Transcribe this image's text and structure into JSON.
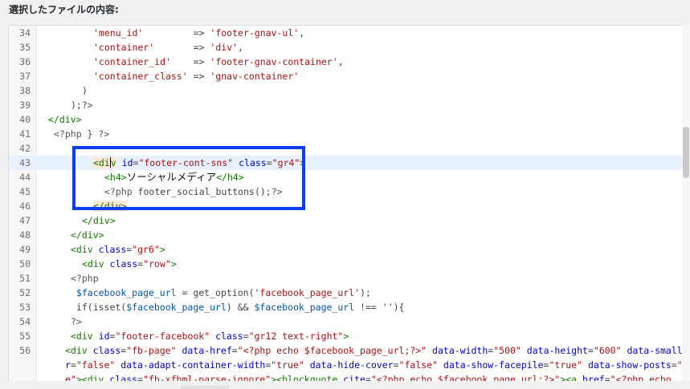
{
  "header": {
    "label": "選択したファイルの内容:"
  },
  "lines": [
    {
      "n": "34",
      "indent": 10,
      "parts": [
        [
          "str",
          "'menu_id'"
        ],
        [
          "op",
          "         => "
        ],
        [
          "str",
          "'footer-gnav-ul'"
        ],
        [
          "op",
          ","
        ]
      ]
    },
    {
      "n": "35",
      "indent": 10,
      "parts": [
        [
          "str",
          "'container'"
        ],
        [
          "op",
          "       => "
        ],
        [
          "str",
          "'div'"
        ],
        [
          "op",
          ","
        ]
      ]
    },
    {
      "n": "36",
      "indent": 10,
      "parts": [
        [
          "str",
          "'container_id'"
        ],
        [
          "op",
          "    => "
        ],
        [
          "str",
          "'footer-gnav-container'"
        ],
        [
          "op",
          ","
        ]
      ]
    },
    {
      "n": "37",
      "indent": 10,
      "parts": [
        [
          "str",
          "'container_class'"
        ],
        [
          "op",
          " => "
        ],
        [
          "str",
          "'gnav-container'"
        ]
      ]
    },
    {
      "n": "38",
      "indent": 8,
      "parts": [
        [
          "op",
          ")"
        ]
      ]
    },
    {
      "n": "39",
      "indent": 6,
      "parts": [
        [
          "op",
          ");"
        ],
        [
          "php",
          "?>"
        ]
      ]
    },
    {
      "n": "40",
      "indent": 2,
      "parts": [
        [
          "tag",
          "</div>"
        ]
      ]
    },
    {
      "n": "41",
      "indent": 3,
      "parts": [
        [
          "php",
          "<?php"
        ],
        [
          "op",
          " } "
        ],
        [
          "php",
          "?>"
        ]
      ]
    },
    {
      "n": "42",
      "indent": 0,
      "parts": []
    },
    {
      "n": "43",
      "indent": 10,
      "active": true,
      "parts": [
        [
          "tag-hl",
          "<div"
        ],
        [
          "op",
          " "
        ],
        [
          "attr",
          "id"
        ],
        [
          "op",
          "="
        ],
        [
          "str",
          "\"footer-cont-sns\""
        ],
        [
          "op",
          " "
        ],
        [
          "attr",
          "class"
        ],
        [
          "op",
          "="
        ],
        [
          "str",
          "\"gr4\""
        ],
        [
          "tag-hl",
          ">"
        ]
      ]
    },
    {
      "n": "44",
      "indent": 12,
      "parts": [
        [
          "tag",
          "<h4>"
        ],
        [
          "ja",
          "ソーシャルメディア"
        ],
        [
          "tag",
          "</h4>"
        ]
      ]
    },
    {
      "n": "45",
      "indent": 12,
      "parts": [
        [
          "php",
          "<?php"
        ],
        [
          "op",
          " footer_social_buttons();"
        ],
        [
          "php",
          "?>"
        ]
      ]
    },
    {
      "n": "46",
      "indent": 10,
      "parts": [
        [
          "tag-hl",
          "</div>"
        ]
      ]
    },
    {
      "n": "47",
      "indent": 8,
      "parts": [
        [
          "tag",
          "</div>"
        ]
      ]
    },
    {
      "n": "48",
      "indent": 6,
      "parts": [
        [
          "tag",
          "</div>"
        ]
      ]
    },
    {
      "n": "49",
      "indent": 6,
      "parts": [
        [
          "tag",
          "<div"
        ],
        [
          "op",
          " "
        ],
        [
          "attr",
          "class"
        ],
        [
          "op",
          "="
        ],
        [
          "str",
          "\"gr6\""
        ],
        [
          "tag",
          ">"
        ]
      ]
    },
    {
      "n": "50",
      "indent": 8,
      "parts": [
        [
          "tag",
          "<div"
        ],
        [
          "op",
          " "
        ],
        [
          "attr",
          "class"
        ],
        [
          "op",
          "="
        ],
        [
          "str",
          "\"row\""
        ],
        [
          "tag",
          ">"
        ]
      ]
    },
    {
      "n": "51",
      "indent": 6,
      "parts": [
        [
          "php",
          "<?php"
        ]
      ]
    },
    {
      "n": "52",
      "indent": 6,
      "parts": [
        [
          "op",
          " "
        ],
        [
          "var",
          "$facebook_page_url"
        ],
        [
          "op",
          " = get_option("
        ],
        [
          "str",
          "'facebook_page_url'"
        ],
        [
          "op",
          ");"
        ]
      ]
    },
    {
      "n": "53",
      "indent": 6,
      "parts": [
        [
          "op",
          " if(isset("
        ],
        [
          "var",
          "$facebook_page_url"
        ],
        [
          "op",
          ") && "
        ],
        [
          "var",
          "$facebook_page_url"
        ],
        [
          "op",
          " !== "
        ],
        [
          "str",
          "''"
        ],
        [
          "op",
          "){"
        ]
      ]
    },
    {
      "n": "54",
      "indent": 6,
      "parts": [
        [
          "php",
          "?>"
        ]
      ]
    },
    {
      "n": "55",
      "indent": 6,
      "parts": [
        [
          "tag",
          "<div"
        ],
        [
          "op",
          " "
        ],
        [
          "attr",
          "id"
        ],
        [
          "op",
          "="
        ],
        [
          "str",
          "\"footer-facebook\""
        ],
        [
          "op",
          " "
        ],
        [
          "attr",
          "class"
        ],
        [
          "op",
          "="
        ],
        [
          "str",
          "\"gr12 text-right\""
        ],
        [
          "tag",
          ">"
        ]
      ]
    }
  ],
  "wrapline": {
    "n": "56",
    "parts": [
      [
        "op",
        "          "
      ],
      [
        "tag",
        "<div"
      ],
      [
        "op",
        " "
      ],
      [
        "attr",
        "class"
      ],
      [
        "op",
        "="
      ],
      [
        "str",
        "\"fb-page\""
      ],
      [
        "op",
        " "
      ],
      [
        "attr",
        "data-href"
      ],
      [
        "op",
        "="
      ],
      [
        "str",
        "\"<?php echo $facebook_page_url;?>\""
      ],
      [
        "op",
        " "
      ],
      [
        "attr",
        "data-width"
      ],
      [
        "op",
        "="
      ],
      [
        "str",
        "\"500\""
      ],
      [
        "op",
        " "
      ],
      [
        "attr",
        "data-height"
      ],
      [
        "op",
        "="
      ],
      [
        "str",
        "\"600\""
      ],
      [
        "op",
        " "
      ],
      [
        "attr",
        "data-small-header"
      ],
      [
        "op",
        "="
      ],
      [
        "str",
        "\"false\""
      ],
      [
        "op",
        " "
      ],
      [
        "attr",
        "data-adapt-container-width"
      ],
      [
        "op",
        "="
      ],
      [
        "str",
        "\"true\""
      ],
      [
        "op",
        " "
      ],
      [
        "attr",
        "data-hide-cover"
      ],
      [
        "op",
        "="
      ],
      [
        "str",
        "\"false\""
      ],
      [
        "op",
        " "
      ],
      [
        "attr",
        "data-show-facepile"
      ],
      [
        "op",
        "="
      ],
      [
        "str",
        "\"true\""
      ],
      [
        "op",
        " "
      ],
      [
        "attr",
        "data-show-posts"
      ],
      [
        "op",
        "="
      ],
      [
        "str",
        "\"false\""
      ],
      [
        "tag",
        "><div"
      ],
      [
        "op",
        " "
      ],
      [
        "attr",
        "class"
      ],
      [
        "op",
        "="
      ],
      [
        "str",
        "\"fb-xfbml-parse-ignore\""
      ],
      [
        "tag",
        "><blockquote"
      ],
      [
        "op",
        " "
      ],
      [
        "attr",
        "cite"
      ],
      [
        "op",
        "="
      ],
      [
        "str",
        "\"<?php echo $facebook_page_url;?>\""
      ],
      [
        "tag",
        "><a"
      ],
      [
        "op",
        " "
      ],
      [
        "attr",
        "href"
      ],
      [
        "op",
        "="
      ],
      [
        "str",
        "\"<?php echo"
      ]
    ]
  },
  "colors": {
    "highlight_box": "#0a3ef0",
    "tag": "#117700",
    "attr": "#0000cc",
    "string": "#aa1111"
  }
}
